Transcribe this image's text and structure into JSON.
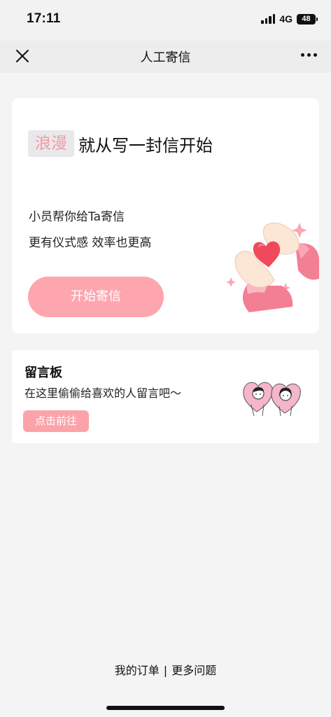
{
  "status_bar": {
    "time": "17:11",
    "network": "4G",
    "battery": "48"
  },
  "nav": {
    "title": "人工寄信",
    "close_icon": "close-icon",
    "more_icon": "more-icon"
  },
  "main_card": {
    "highlight_tag": "浪漫",
    "headline": "就从写一封信开始",
    "desc_line1": "小员帮你给Ta寄信",
    "desc_line2": "更有仪式感 效率也更高",
    "button_label": "开始寄信",
    "illustration": "heart-hands-illustration",
    "accent_color": "#fda6ae"
  },
  "board_card": {
    "title": "留言板",
    "subtitle": "在这里偷偷给喜欢的人留言吧～",
    "button_label": "点击前往",
    "illustration": "couple-hearts-illustration"
  },
  "footer": {
    "my_orders": "我的订单",
    "separator": "|",
    "more_questions": "更多问题"
  }
}
